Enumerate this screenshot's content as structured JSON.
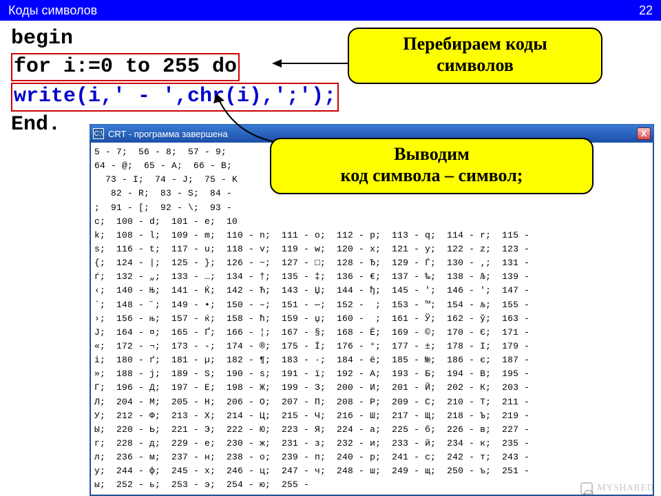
{
  "header": {
    "title": "Коды символов",
    "page": "22"
  },
  "code": {
    "l1": "begin",
    "l2": "for i:=0 to 255 do",
    "l3": "write(i,' - ',chr(i),';');",
    "l4": "End."
  },
  "callout1": {
    "line1": "Перебираем коды",
    "line2": "символов"
  },
  "callout2": {
    "line1": "Выводим",
    "line2": "код символа – символ;"
  },
  "window": {
    "title": "CRT - программа завершена",
    "icon_label": "C:\\",
    "close_label": "X"
  },
  "crt_rows": [
    "5 - 7;  56 - 8;  57 - 9;",
    "64 - @;  65 - A;  66 - B;",
    "  73 - I;  74 - J;  75 - K",
    "   82 - R;  83 - S;  84 - ",
    ";  91 - [;  92 - \\;  93 -",
    "c;  100 - d;  101 - e;  10",
    "k;  108 - l;  109 - m;  110 - n;  111 - o;  112 - p;  113 - q;  114 - r;  115 -",
    "s;  116 - t;  117 - u;  118 - v;  119 - w;  120 - x;  121 - y;  122 - z;  123 -",
    "{;  124 - |;  125 - };  126 - ~;  127 - □;  128 - Ђ;  129 - Ѓ;  130 - ‚;  131 -",
    "ѓ;  132 - „;  133 - …;  134 - †;  135 - ‡;  136 - €;  137 - ‰;  138 - Љ;  139 -",
    "‹;  140 - Њ;  141 - Ќ;  142 - Ћ;  143 - Џ;  144 - ђ;  145 - ';  146 - ';  147 -",
    "`;  148 - ˝;  149 - •;  150 - –;  151 - —;  152 -  ;  153 - ™;  154 - љ;  155 -",
    "›;  156 - њ;  157 - ќ;  158 - ћ;  159 - џ;  160 -  ;  161 - Ў;  162 - ў;  163 -",
    "Ј;  164 - ¤;  165 - Ґ;  166 - ¦;  167 - §;  168 - Ё;  169 - ©;  170 - Є;  171 -",
    "«;  172 - ¬;  173 - -;  174 - ®;  175 - Ї;  176 - °;  177 - ±;  178 - І;  179 -",
    "і;  180 - ґ;  181 - µ;  182 - ¶;  183 - ·;  184 - ё;  185 - №;  186 - є;  187 -",
    "»;  188 - ј;  189 - Ѕ;  190 - ѕ;  191 - ї;  192 - А;  193 - Б;  194 - В;  195 -",
    "Г;  196 - Д;  197 - Е;  198 - Ж;  199 - З;  200 - И;  201 - Й;  202 - К;  203 -",
    "Л;  204 - М;  205 - Н;  206 - О;  207 - П;  208 - Р;  209 - С;  210 - Т;  211 -",
    "У;  212 - Ф;  213 - Х;  214 - Ц;  215 - Ч;  216 - Ш;  217 - Щ;  218 - Ъ;  219 -",
    "Ы;  220 - Ь;  221 - Э;  222 - Ю;  223 - Я;  224 - а;  225 - б;  226 - в;  227 -",
    "г;  228 - д;  229 - е;  230 - ж;  231 - з;  232 - и;  233 - й;  234 - к;  235 -",
    "л;  236 - м;  237 - н;  238 - о;  239 - п;  240 - р;  241 - с;  242 - т;  243 -",
    "у;  244 - ф;  245 - х;  246 - ц;  247 - ч;  248 - ш;  249 - щ;  250 - ъ;  251 -",
    "ы;  252 - ь;  253 - э;  254 - ю;  255 -"
  ],
  "watermark": "MYSHARED"
}
